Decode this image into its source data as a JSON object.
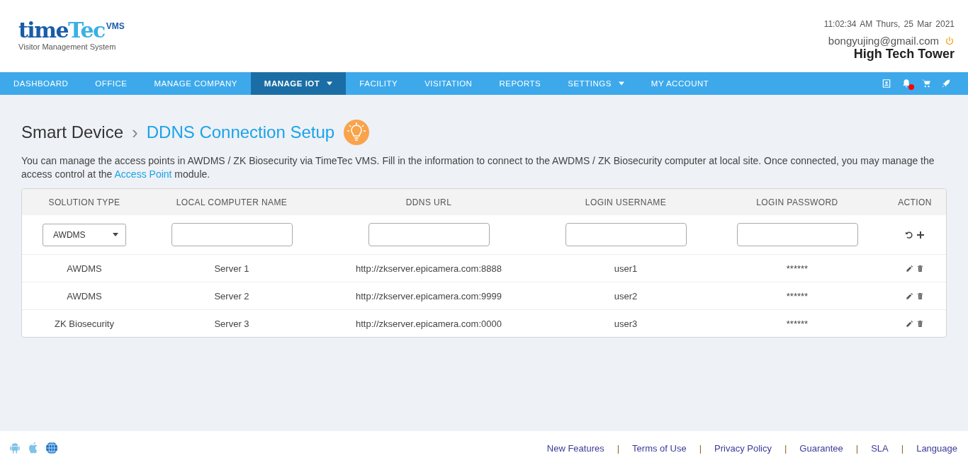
{
  "logo": {
    "brand_main": "time",
    "brand_accent": "Tec",
    "badge": "VMS",
    "tagline": "Visitor Management System"
  },
  "header": {
    "time": "11:02:34 AM",
    "date": "Thurs, 25 Mar 2021",
    "email": "bongyujing@gmail.com",
    "site": "High Tech Tower"
  },
  "nav": {
    "items": [
      {
        "label": "DASHBOARD",
        "selected": false,
        "has_menu": false
      },
      {
        "label": "OFFICE",
        "selected": false,
        "has_menu": false
      },
      {
        "label": "MANAGE COMPANY",
        "selected": false,
        "has_menu": false
      },
      {
        "label": "MANAGE IOT",
        "selected": true,
        "has_menu": true
      },
      {
        "label": "FACILITY",
        "selected": false,
        "has_menu": false
      },
      {
        "label": "VISITATION",
        "selected": false,
        "has_menu": false
      },
      {
        "label": "REPORTS",
        "selected": false,
        "has_menu": false
      },
      {
        "label": "SETTINGS",
        "selected": false,
        "has_menu": true
      },
      {
        "label": "MY ACCOUNT",
        "selected": false,
        "has_menu": false
      }
    ],
    "notification_unread": true
  },
  "breadcrumb": {
    "parent": "Smart Device",
    "separator": "›",
    "current": "DDNS Connection Setup"
  },
  "description": {
    "before": "You can manage the access points in AWDMS / ZK Biosecurity via TimeTec VMS. Fill in the information to connect to the AWDMS / ZK Biosecurity computer at local site. Once connected, you may manage the access control at the ",
    "link": "Access Point",
    "after": " module."
  },
  "table": {
    "columns": [
      "SOLUTION TYPE",
      "LOCAL COMPUTER NAME",
      "DDNS URL",
      "LOGIN USERNAME",
      "LOGIN PASSWORD",
      "ACTION"
    ],
    "filter": {
      "solution_type": "AWDMS"
    },
    "rows": [
      {
        "solution_type": "AWDMS",
        "computer_name": "Server 1",
        "ddns_url": "http://zkserver.epicamera.com:8888",
        "username": "user1",
        "password": "******"
      },
      {
        "solution_type": "AWDMS",
        "computer_name": "Server 2",
        "ddns_url": "http://zkserver.epicamera.com:9999",
        "username": "user2",
        "password": "******"
      },
      {
        "solution_type": "ZK Biosecurity",
        "computer_name": "Server 3",
        "ddns_url": "http://zkserver.epicamera.com:0000",
        "username": "user3",
        "password": "******"
      }
    ]
  },
  "footer": {
    "separator": "|",
    "links": [
      "New Features",
      "Terms of Use",
      "Privacy Policy",
      "Guarantee",
      "SLA",
      "Language"
    ]
  }
}
